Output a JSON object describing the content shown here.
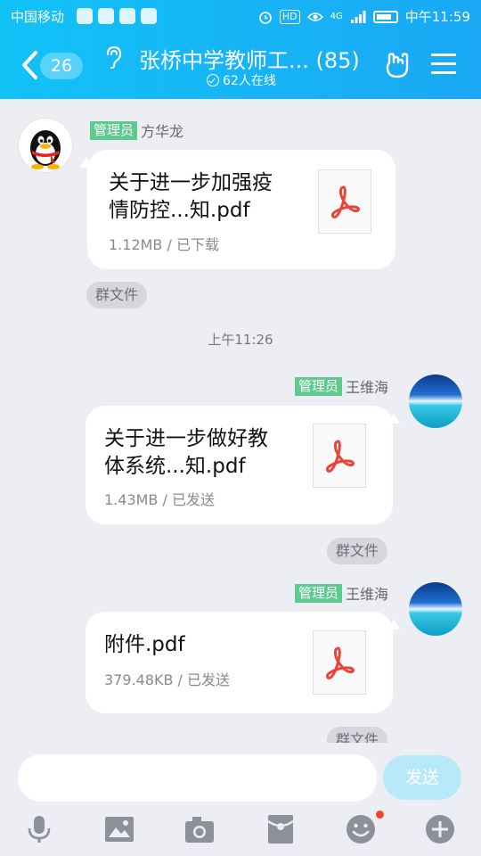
{
  "status_bar": {
    "carrier": "中国移动",
    "hd_badge": "HD",
    "network": "4G",
    "time": "中午11:59"
  },
  "header": {
    "unread_count": "26",
    "title": "张桥中学教师工... (85)",
    "online_text": "62人在线"
  },
  "messages": [
    {
      "sender_role": "管理员",
      "sender_name": "方华龙",
      "file_name_line1": "关于进一步加强疫",
      "file_name_line2": "情防控...知.pdf",
      "file_meta": "1.12MB / 已下载",
      "source_label": "群文件",
      "avatar_icon": "qq-penguin-icon"
    },
    {
      "sender_role": "管理员",
      "sender_name": "王维海",
      "file_name_line1": "关于进一步做好教",
      "file_name_line2": "体系统...知.pdf",
      "file_meta": "1.43MB / 已发送",
      "source_label": "群文件",
      "avatar_icon": "sea-avatar"
    },
    {
      "sender_role": "管理员",
      "sender_name": "王维海",
      "file_name_line1": "附件.pdf",
      "file_meta": "379.48KB / 已发送",
      "source_label": "群文件",
      "avatar_icon": "sea-avatar"
    }
  ],
  "timestamp": "上午11:26",
  "input": {
    "value": "",
    "send_label": "发送"
  },
  "toolbar": [
    "microphone-icon",
    "image-icon",
    "camera-icon",
    "red-packet-icon",
    "emoji-icon",
    "plus-icon"
  ],
  "colors": {
    "header": "#1aa8f5",
    "admin_tag": "#5ccb8d",
    "send_button": "#b7e9f9",
    "pdf_red": "#e9443a",
    "badge_dot": "#f2432d"
  }
}
